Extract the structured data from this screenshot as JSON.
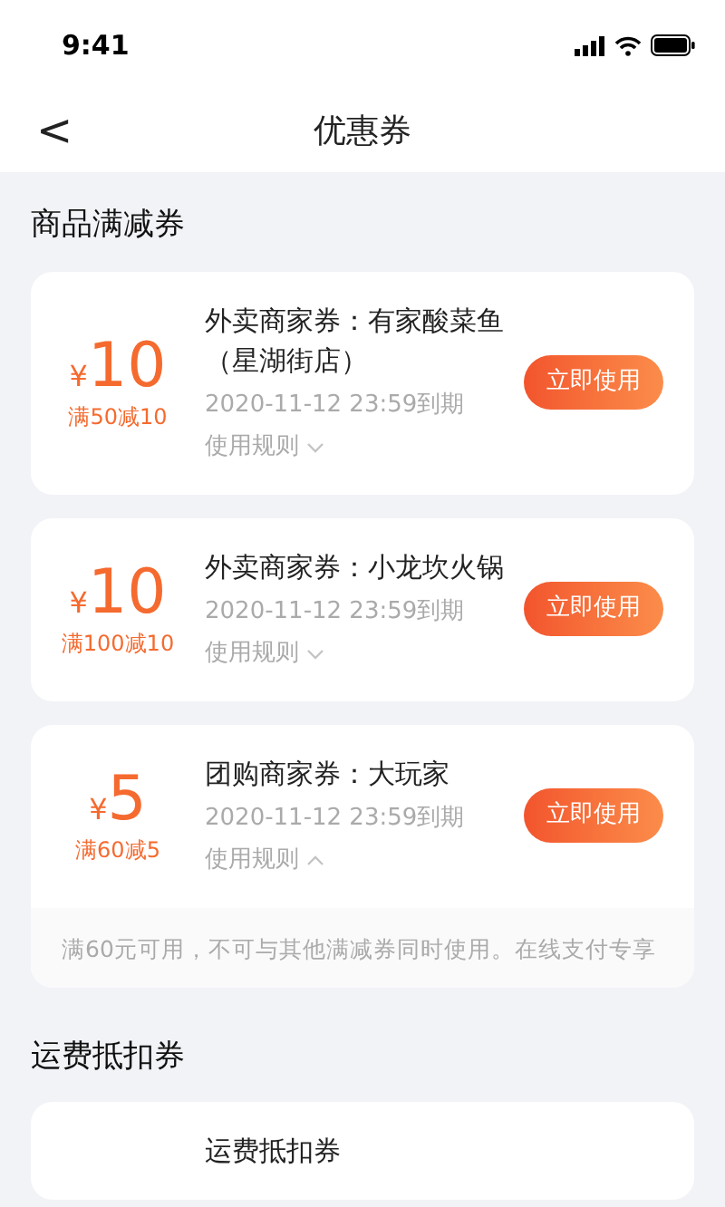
{
  "status_bar": {
    "time": "9:41"
  },
  "header": {
    "back": "<",
    "title": "优惠券"
  },
  "sections": [
    {
      "title": "商品满减券",
      "coupons": [
        {
          "currency": "¥",
          "amount": "10",
          "condition": "满50减10",
          "title": "外卖商家券：有家酸菜鱼（星湖街店）",
          "expiry": "2020-11-12 23:59到期",
          "rules_label": "使用规则",
          "rules_expanded": false,
          "button": "立即使用"
        },
        {
          "currency": "¥",
          "amount": "10",
          "condition": "满100减10",
          "title": "外卖商家券：小龙坎火锅",
          "expiry": "2020-11-12 23:59到期",
          "rules_label": "使用规则",
          "rules_expanded": false,
          "button": "立即使用"
        },
        {
          "currency": "¥",
          "amount": "5",
          "condition": "满60减5",
          "title": "团购商家券：大玩家",
          "expiry": "2020-11-12 23:59到期",
          "rules_label": "使用规则",
          "rules_expanded": true,
          "rules_text": "满60元可用，不可与其他满减券同时使用。在线支付专享",
          "button": "立即使用"
        }
      ]
    },
    {
      "title": "运费抵扣券",
      "coupons": [
        {
          "title": "运费抵扣券"
        }
      ]
    }
  ]
}
